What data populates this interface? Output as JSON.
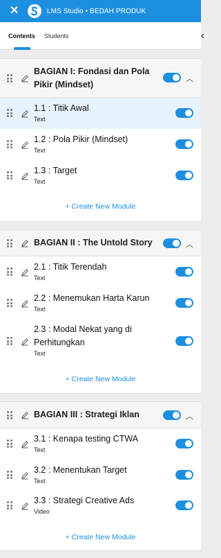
{
  "app": {
    "title": "LMS Studio • BEDAH PRODUK"
  },
  "tabs": {
    "contents": "Contents",
    "students": "Students"
  },
  "colors": {
    "accent": "#1d8fe0",
    "highlight": "#e6f2fc"
  },
  "icons": {
    "close": "close-icon",
    "logo": "logo-icon",
    "drag": "drag-handle-icon",
    "edit": "pencil-icon",
    "collapse": "chevron-up-icon",
    "panel": "double-chevron-left-icon"
  },
  "create_label": "+ Create New Module",
  "sections": [
    {
      "title_line1": "BAGIAN I: Fondasi dan Pola",
      "title_line2": "Pikir (Mindset)",
      "items": [
        {
          "title": "1.1 : Titik Awal",
          "type": "Text"
        },
        {
          "title": "1.2 : Pola Pikir (Mindset)",
          "type": "Text"
        },
        {
          "title": "1.3 : Target",
          "type": "Text"
        }
      ]
    },
    {
      "title_line1": "BAGIAN II : The Untold Story",
      "items": [
        {
          "title": "2.1 : Titik Terendah",
          "type": "Text"
        },
        {
          "title": "2.2 : Menemukan Harta Karun",
          "type": "Text"
        },
        {
          "title_line1": "2.3 : Modal Nekat yang di",
          "title_line2": "Perhitungkan",
          "type": "Text"
        }
      ]
    },
    {
      "title_line1": "BAGIAN III : Strategi Iklan",
      "items": [
        {
          "title": "3.1 : Kenapa testing CTWA",
          "type": "Text"
        },
        {
          "title": "3.2 : Menentukan Target",
          "type": "Text"
        },
        {
          "title": "3.3 : Strategi Creative Ads",
          "type": "Video"
        }
      ]
    }
  ]
}
